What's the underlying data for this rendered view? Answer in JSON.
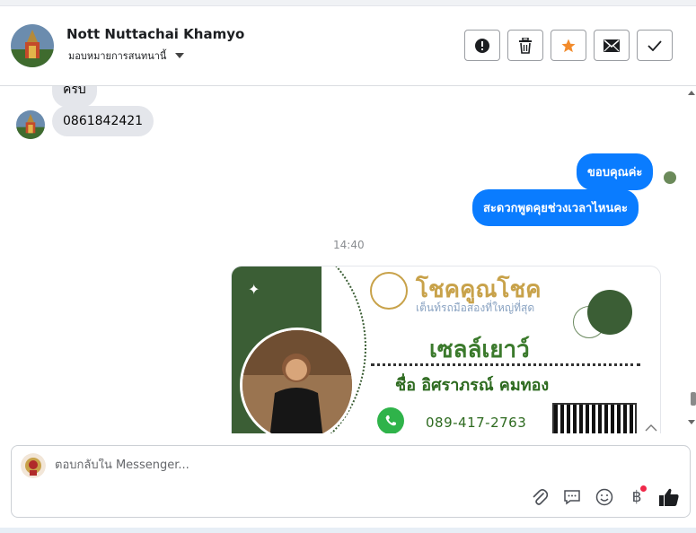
{
  "header": {
    "contact_name": "Nott Nuttachai Khamyo",
    "assignment": "มอบหมายการสนทนานี้",
    "actions": [
      "report-icon",
      "trash-icon",
      "star-icon",
      "mail-icon",
      "check-icon"
    ]
  },
  "messages": {
    "partial_incoming": "ครับ",
    "incoming_phone": "0861842421",
    "outgoing_1": "ขอบคุณค่ะ",
    "outgoing_2": "สะดวกพูดคุยช่วงเวลาไหนคะ",
    "timestamp": "14:40"
  },
  "card": {
    "brand": "โชคคูณโชค",
    "tagline": "เต็นท์รถมือสองที่ใหญ่ที่สุด",
    "role": "เซลล์เยาว์",
    "person": "ชื่อ อิศราภรณ์  คมทอง",
    "phone": "089-417-2763"
  },
  "composer": {
    "placeholder": "ตอบกลับใน Messenger..."
  },
  "colors": {
    "accent_blue": "#0a7cff",
    "star_orange": "#f28b2c",
    "card_green": "#3b5e35",
    "notification_red": "#f02849"
  }
}
